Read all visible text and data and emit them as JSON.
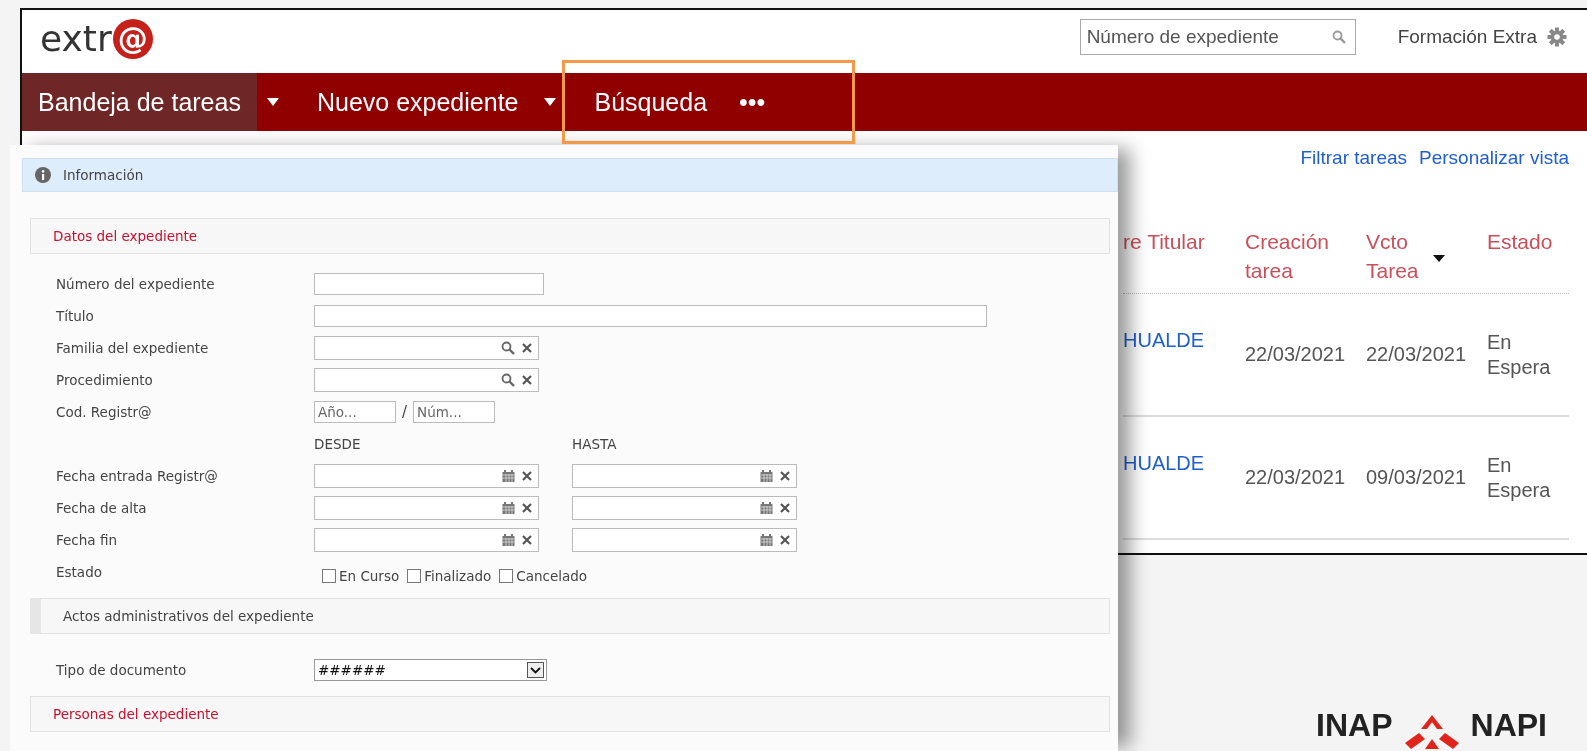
{
  "header": {
    "logo": {
      "text": "extr",
      "mark": "@"
    },
    "search": {
      "placeholder": "Número de expediente"
    },
    "user": "Formación Extra"
  },
  "nav": [
    {
      "label": "Bandeja de tareas",
      "selected": true,
      "dropdown": true
    },
    {
      "label": "Nuevo expediente",
      "selected": false,
      "dropdown": true
    },
    {
      "label": "Búsqueda",
      "selected": false,
      "dropdown": false
    },
    {
      "label": "•••",
      "selected": false,
      "dropdown": false
    }
  ],
  "links": [
    "Filtrar tareas",
    "Personalizar vista"
  ],
  "table": {
    "columns": [
      {
        "label": "re Titular",
        "sorted": false
      },
      {
        "label": "Creación tarea",
        "sorted": false
      },
      {
        "label": "Vcto Tarea",
        "sorted": true
      },
      {
        "label": "Estado",
        "sorted": false
      }
    ],
    "rows": [
      [
        "HUALDE",
        "22/03/2021",
        "22/03/2021",
        "En Espera"
      ],
      [
        "HUALDE",
        "22/03/2021",
        "09/03/2021",
        "En Espera"
      ]
    ]
  },
  "dialog": {
    "info": "Información",
    "sections": [
      {
        "title": "Datos del expediente",
        "kind": "accent",
        "fields": [
          {
            "kind": "text",
            "label": "Número del expediente"
          },
          {
            "kind": "wide",
            "label": "Título"
          },
          {
            "kind": "lookup",
            "label": "Familia del expediente"
          },
          {
            "kind": "lookup",
            "label": "Procedimiento"
          },
          {
            "kind": "code",
            "label": "Cod. Registr@",
            "placeholders": [
              "Año...",
              "Núm..."
            ],
            "separator": "/"
          },
          {
            "kind": "range-header",
            "from": "DESDE",
            "to": "HASTA"
          },
          {
            "kind": "date-range",
            "label": "Fecha entrada Registr@"
          },
          {
            "kind": "date-range",
            "label": "Fecha de alta"
          },
          {
            "kind": "date-range",
            "label": "Fecha fin"
          },
          {
            "kind": "checks",
            "label": "Estado",
            "options": [
              {
                "label": "En Curso",
                "checked": false
              },
              {
                "label": "Finalizado",
                "checked": false
              },
              {
                "label": "Cancelado",
                "checked": false
              }
            ]
          }
        ]
      },
      {
        "title": "Actos administrativos del expediente",
        "kind": "plain",
        "fields": [
          {
            "kind": "select",
            "label": "Tipo de documento",
            "value": "######"
          }
        ]
      },
      {
        "title": "Personas del expediente",
        "kind": "accent"
      }
    ]
  },
  "footer_logo": {
    "left": "INAP",
    "right": "NAPI"
  }
}
